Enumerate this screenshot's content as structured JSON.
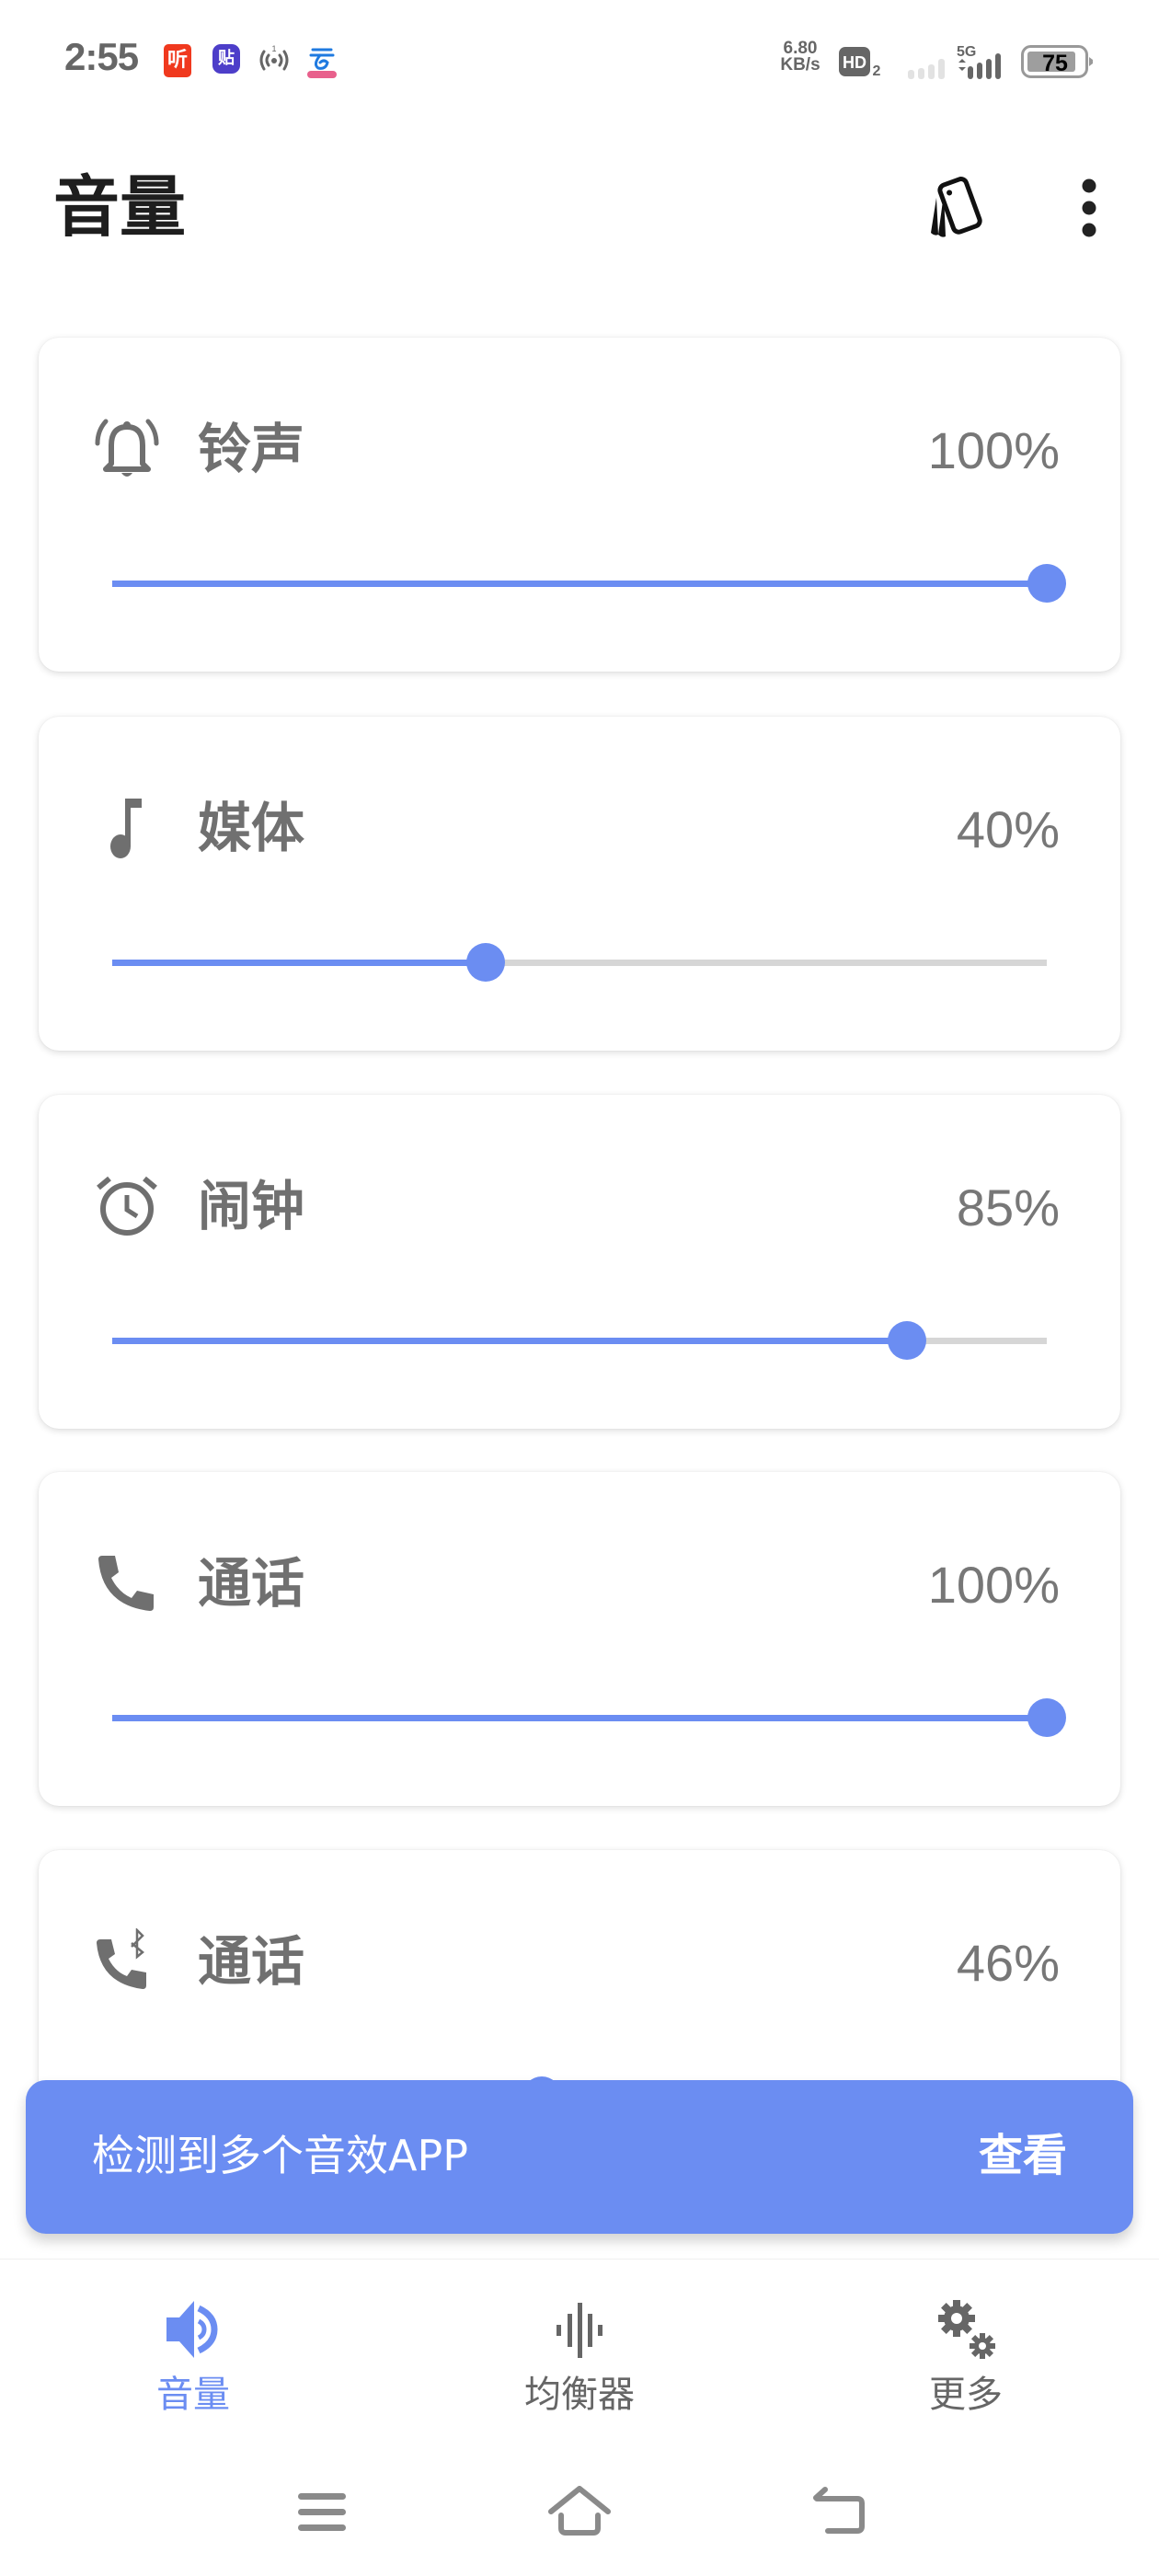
{
  "status_bar": {
    "time": "2:55",
    "notification_icons": [
      "ximalaya-ting-icon",
      "tieba-icon",
      "hotspot-icon",
      "cloud-ai-icon"
    ],
    "ting_glyph": "听",
    "tie_glyph": "贴",
    "net_speed_value": "6.80",
    "net_speed_unit": "KB/s",
    "hd_label": "HD",
    "hd_sub": "2",
    "network_type": "5G",
    "battery_level": "75"
  },
  "header": {
    "title": "音量",
    "actions": [
      "ring-mode-icon",
      "more-options-icon"
    ]
  },
  "colors": {
    "accent": "#6b8df2",
    "track_inactive": "#d6d6d6",
    "text_secondary": "#707070",
    "icon_gray": "#6f6f6f"
  },
  "volume_streams": [
    {
      "id": "ringtone",
      "icon": "bell-ringing-icon",
      "label": "铃声",
      "percent_text": "100%",
      "value": 100
    },
    {
      "id": "media",
      "icon": "music-note-icon",
      "label": "媒体",
      "percent_text": "40%",
      "value": 40
    },
    {
      "id": "alarm",
      "icon": "alarm-clock-icon",
      "label": "闹钟",
      "percent_text": "85%",
      "value": 85
    },
    {
      "id": "call",
      "icon": "phone-icon",
      "label": "通话",
      "percent_text": "100%",
      "value": 100
    },
    {
      "id": "bluetooth-call",
      "icon": "bluetooth-phone-icon",
      "label": "通话",
      "percent_text": "46%",
      "value": 46
    }
  ],
  "toast": {
    "message": "检测到多个音效APP",
    "action": "查看"
  },
  "bottom_nav": {
    "items": [
      {
        "id": "volume",
        "label": "音量",
        "icon": "speaker-icon",
        "active": true
      },
      {
        "id": "equalizer",
        "label": "均衡器",
        "icon": "equalizer-icon",
        "active": false
      },
      {
        "id": "more",
        "label": "更多",
        "icon": "gears-icon",
        "active": false
      }
    ]
  },
  "system_nav": {
    "buttons": [
      "recents-icon",
      "home-icon",
      "back-icon"
    ]
  }
}
